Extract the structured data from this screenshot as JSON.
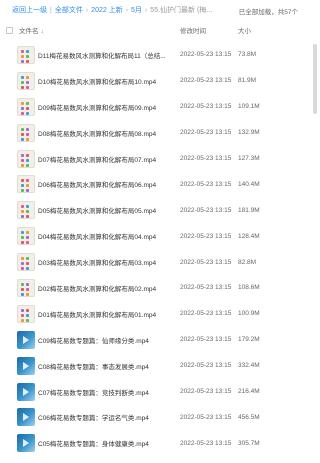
{
  "breadcrumb": {
    "back": "返回上一级",
    "items": [
      "全部文件",
      "2022 上新",
      "5月",
      "55.仙护门最新 (梅..."
    ]
  },
  "status": "已全部加载，共57个",
  "columns": {
    "name": "文件名",
    "time": "修改时间",
    "size": "大小"
  },
  "files": [
    {
      "name": "D11梅花易数风水测算和化解布局11（总结...",
      "time": "2022-05-23 13:15",
      "size": "73.8M",
      "kind": "doc"
    },
    {
      "name": "D10梅花易数风水测算和化解布局10.mp4",
      "time": "2022-05-23 13:15",
      "size": "81.9M",
      "kind": "doc"
    },
    {
      "name": "D09梅花易数风水测算和化解布局09.mp4",
      "time": "2022-05-23 13:15",
      "size": "109.1M",
      "kind": "doc"
    },
    {
      "name": "D08梅花易数风水测算和化解布局08.mp4",
      "time": "2022-05-23 13:15",
      "size": "132.9M",
      "kind": "doc"
    },
    {
      "name": "D07梅花易数风水测算和化解布局07.mp4",
      "time": "2022-05-23 13:15",
      "size": "127.3M",
      "kind": "doc"
    },
    {
      "name": "D06梅花易数风水测算和化解布局06.mp4",
      "time": "2022-05-23 13:15",
      "size": "140.4M",
      "kind": "doc"
    },
    {
      "name": "D05梅花易数风水测算和化解布局05.mp4",
      "time": "2022-05-23 13:15",
      "size": "181.9M",
      "kind": "doc"
    },
    {
      "name": "D04梅花易数风水测算和化解布局04.mp4",
      "time": "2022-05-23 13:15",
      "size": "128.4M",
      "kind": "doc"
    },
    {
      "name": "D03梅花易数风水测算和化解布局03.mp4",
      "time": "2022-05-23 13:15",
      "size": "82.8M",
      "kind": "doc"
    },
    {
      "name": "D02梅花易数风水测算和化解布局02.mp4",
      "time": "2022-05-23 13:15",
      "size": "108.6M",
      "kind": "doc"
    },
    {
      "name": "D01梅花易数风水测算和化解布局01.mp4",
      "time": "2022-05-23 13:15",
      "size": "100.9M",
      "kind": "doc"
    },
    {
      "name": "C09梅花易数专题篇：仙师缘分类.mp4",
      "time": "2022-05-23 13:15",
      "size": "179.2M",
      "kind": "vid"
    },
    {
      "name": "C08梅花易数专题篇：事态发展类.mp4",
      "time": "2022-05-23 13:15",
      "size": "332.4M",
      "kind": "vid"
    },
    {
      "name": "C07梅花易数专题篇：竞技判断类.mp4",
      "time": "2022-05-23 13:15",
      "size": "216.4M",
      "kind": "vid"
    },
    {
      "name": "C06梅花易数专题篇：学运名气类.mp4",
      "time": "2022-05-23 13:15",
      "size": "456.5M",
      "kind": "vid"
    },
    {
      "name": "C05梅花易数专题篇：身体健康类.mp4",
      "time": "2022-05-23 13:15",
      "size": "305.7M",
      "kind": "vid"
    }
  ],
  "icons": {
    "doc": "document-thumbnail-icon",
    "vid": "video-thumbnail-icon",
    "sort": "sort-arrow-icon"
  },
  "colors": {
    "link": "#2d8cf0",
    "text": "#333333",
    "muted": "#666666"
  }
}
